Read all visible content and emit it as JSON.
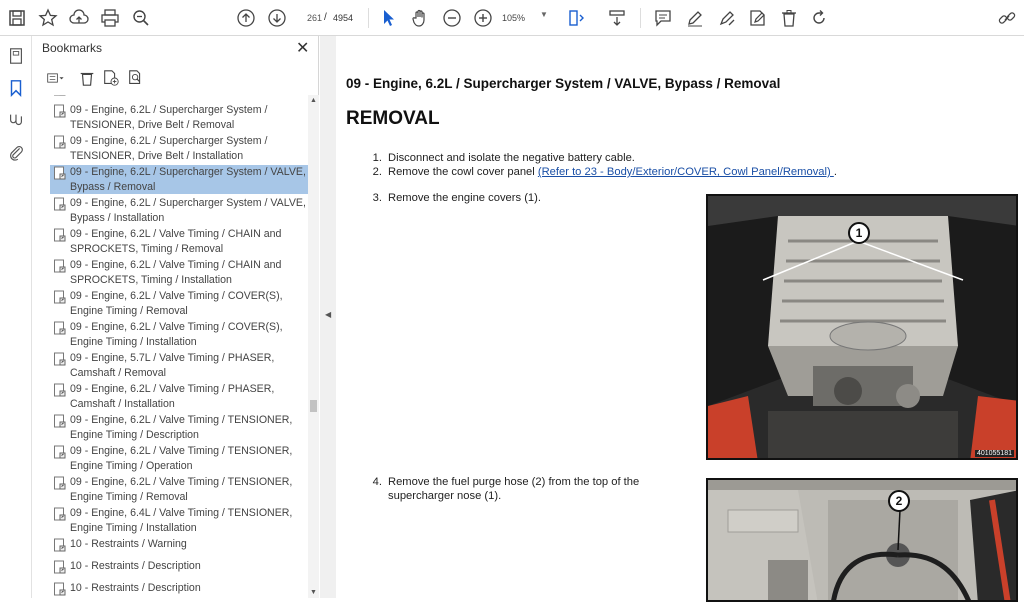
{
  "toolbar": {
    "page_current": "261",
    "page_sep": "/",
    "page_total": "4954",
    "zoom": "105%"
  },
  "panel": {
    "title": "Bookmarks",
    "close": "✕"
  },
  "bookmarks": [
    {
      "label": "SUPERCHARGER / Installation"
    },
    {
      "label": "09 - Engine, 6.2L / Supercharger System / TENSIONER, Drive Belt / Removal"
    },
    {
      "label": "09 - Engine, 6.2L / Supercharger System / TENSIONER, Drive Belt / Installation"
    },
    {
      "label": "09 - Engine, 6.2L / Supercharger System / VALVE, Bypass / Removal",
      "selected": true
    },
    {
      "label": "09 - Engine, 6.2L / Supercharger System / VALVE, Bypass / Installation"
    },
    {
      "label": "09 - Engine, 6.2L / Valve Timing / CHAIN and SPROCKETS, Timing / Removal"
    },
    {
      "label": "09 - Engine, 6.2L / Valve Timing / CHAIN and SPROCKETS, Timing / Installation"
    },
    {
      "label": "09 - Engine, 6.2L / Valve Timing / COVER(S), Engine Timing / Removal"
    },
    {
      "label": "09 - Engine, 6.2L / Valve Timing / COVER(S), Engine Timing / Installation"
    },
    {
      "label": "09 - Engine, 5.7L / Valve Timing / PHASER, Camshaft / Removal"
    },
    {
      "label": "09 - Engine, 6.2L / Valve Timing / PHASER, Camshaft / Installation"
    },
    {
      "label": "09 - Engine, 6.2L / Valve Timing / TENSIONER, Engine Timing / Description"
    },
    {
      "label": "09 - Engine, 6.2L / Valve Timing / TENSIONER, Engine Timing / Operation"
    },
    {
      "label": "09 - Engine, 6.2L / Valve Timing / TENSIONER, Engine Timing / Removal"
    },
    {
      "label": "09 - Engine, 6.4L / Valve Timing / TENSIONER, Engine Timing / Installation"
    },
    {
      "label": "10 - Restraints / Warning"
    },
    {
      "label": "10 - Restraints / Description"
    },
    {
      "label": "10 - Restraints / Description"
    }
  ],
  "document": {
    "heading": "09 - Engine, 6.2L / Supercharger System / VALVE, Bypass / Removal",
    "section": "REMOVAL",
    "steps": [
      {
        "num": "1.",
        "text": "Disconnect and isolate the negative battery cable."
      },
      {
        "num": "2.",
        "text": "Remove the cowl cover panel ",
        "link": "(Refer to 23 - Body/Exterior/COVER, Cowl Panel/Removal) ",
        "after": "."
      },
      {
        "num": "3.",
        "text": "Remove the engine covers (1)."
      },
      {
        "num": "4.",
        "text": "Remove the fuel purge hose (2) from the top of the",
        "text2": "supercharger nose (1)."
      }
    ],
    "photo1": {
      "callout": "1",
      "id": "401055181"
    },
    "photo2": {
      "callout": "2"
    }
  },
  "colors": {
    "selected_bookmark": "#a7c6e7",
    "link": "#1a4fa6",
    "toolbar_accent": "#1a5fd0"
  }
}
